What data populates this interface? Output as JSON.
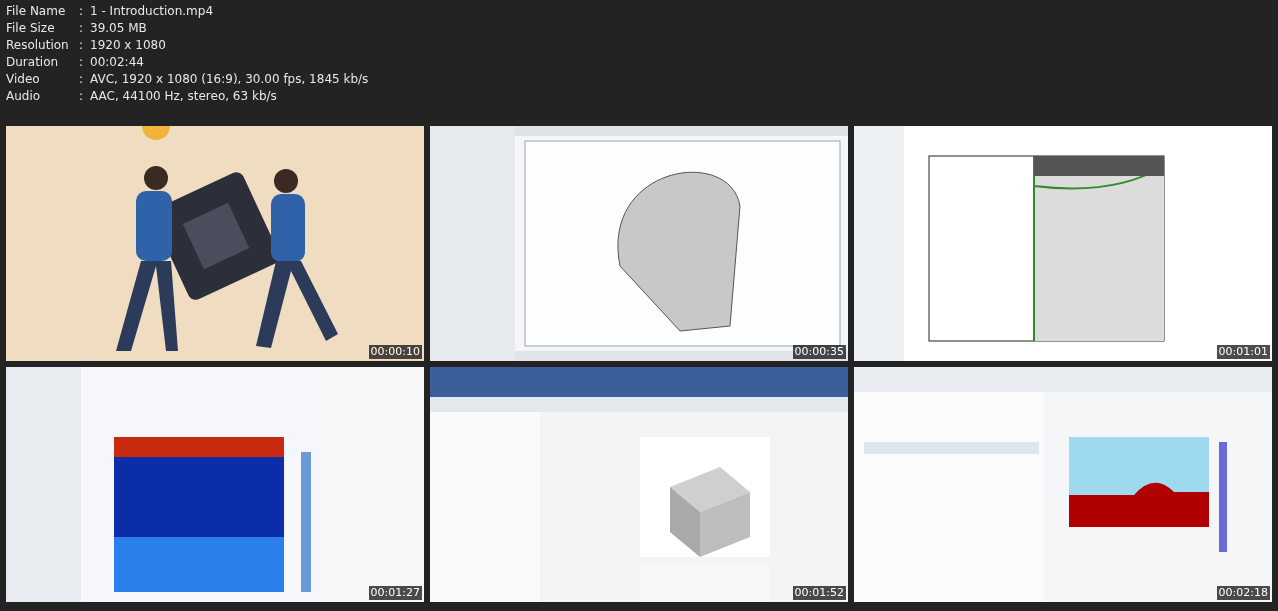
{
  "file_info": [
    {
      "label": "File Name",
      "separator": ":",
      "value": "1 - Introduction.mp4"
    },
    {
      "label": "File Size",
      "separator": ":",
      "value": "39.05 MB"
    },
    {
      "label": "Resolution",
      "separator": ":",
      "value": "1920 x 1080"
    },
    {
      "label": "Duration",
      "separator": ":",
      "value": "00:02:44"
    },
    {
      "label": "Video",
      "separator": ":",
      "value": "AVC, 1920 x 1080 (16:9), 30.00 fps, 1845 kb/s"
    },
    {
      "label": "Audio",
      "separator": ":",
      "value": "AAC, 44100 Hz, stereo, 63 kb/s"
    }
  ],
  "thumbnails": [
    {
      "kind": "picture",
      "timestamp": "00:00:10"
    },
    {
      "kind": "picture",
      "timestamp": "00:00:35"
    },
    {
      "kind": "picture",
      "timestamp": "00:01:01"
    },
    {
      "kind": "picture",
      "timestamp": "00:01:27"
    },
    {
      "kind": "picture",
      "timestamp": "00:01:52"
    },
    {
      "kind": "picture",
      "timestamp": "00:02:18"
    }
  ]
}
